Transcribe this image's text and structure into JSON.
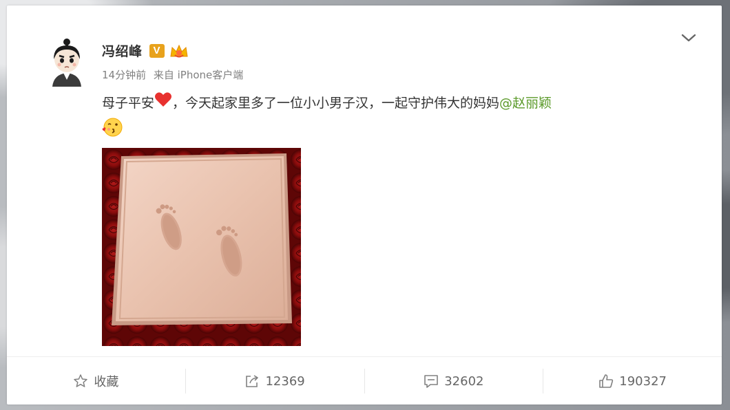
{
  "post": {
    "user_name": "冯绍峰",
    "v_badge": "V",
    "meta_time": "14分钟前",
    "meta_source": "来自 iPhone客户端",
    "text_before": "母子平安",
    "text_middle": "，今天起家里多了一位小小男子汉，一起守护伟大的妈妈",
    "mention": "@赵丽颖"
  },
  "actions": {
    "favorite_label": "收藏",
    "repost_count": "12369",
    "comment_count": "32602",
    "like_count": "190327"
  },
  "colors": {
    "mention": "#5b9a2a",
    "v_badge": "#e8a21c",
    "heart": "#e8312f"
  },
  "icons": [
    "avatar-icon",
    "verified-v-icon",
    "crown-badge-icon",
    "chevron-down-icon",
    "heart-emoji-icon",
    "kiss-emoji-icon",
    "star-icon",
    "repost-icon",
    "comment-icon",
    "like-icon"
  ]
}
